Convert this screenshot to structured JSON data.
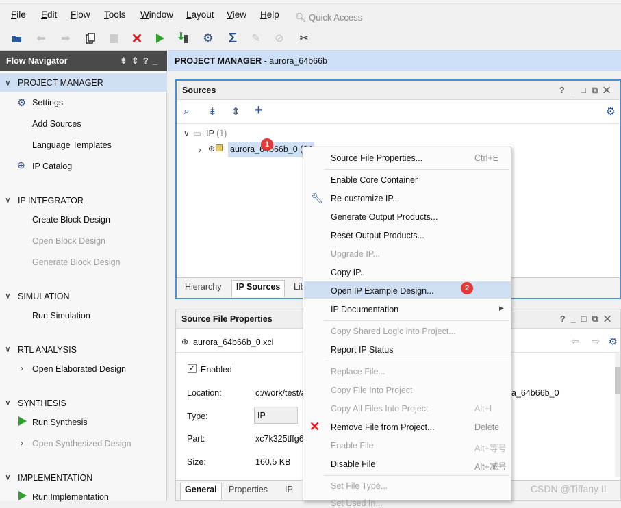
{
  "menubar": {
    "items": [
      "File",
      "Edit",
      "Flow",
      "Tools",
      "Window",
      "Layout",
      "View",
      "Help"
    ],
    "quick_access": "Quick Access"
  },
  "flow_navigator": {
    "title": "Flow Navigator",
    "sections": [
      {
        "title": "PROJECT MANAGER",
        "items": [
          {
            "label": "Settings",
            "icon": "gear-icon"
          },
          {
            "label": "Add Sources"
          },
          {
            "label": "Language Templates"
          },
          {
            "label": "IP Catalog",
            "icon": "ip-icon"
          }
        ]
      },
      {
        "title": "IP INTEGRATOR",
        "items": [
          {
            "label": "Create Block Design"
          },
          {
            "label": "Open Block Design",
            "disabled": true
          },
          {
            "label": "Generate Block Design",
            "disabled": true
          }
        ]
      },
      {
        "title": "SIMULATION",
        "items": [
          {
            "label": "Run Simulation"
          }
        ]
      },
      {
        "title": "RTL ANALYSIS",
        "items": [
          {
            "label": "Open Elaborated Design"
          }
        ]
      },
      {
        "title": "SYNTHESIS",
        "items": [
          {
            "label": "Run Synthesis"
          },
          {
            "label": "Open Synthesized Design",
            "disabled": true
          }
        ]
      },
      {
        "title": "IMPLEMENTATION",
        "items": [
          {
            "label": "Run Implementation"
          }
        ]
      }
    ]
  },
  "project_bar": {
    "title": "PROJECT MANAGER",
    "project": " - aurora_64b66b"
  },
  "sources": {
    "title": "Sources",
    "tree_root": "IP",
    "tree_root_count": " (1)",
    "tree_item": "aurora_64b66b_0 (64",
    "tabs": [
      "Hierarchy",
      "IP Sources",
      "Lib"
    ]
  },
  "source_file_properties": {
    "title": "Source File Properties",
    "file": "aurora_64b66b_0.xci",
    "enabled_label": "Enabled",
    "location_label": "Location:",
    "location_value": "c:/work/test/a",
    "location_tail": "a_64b66b_0",
    "type_label": "Type:",
    "type_value": "IP",
    "part_label": "Part:",
    "part_value": "xc7k325tffg6",
    "size_label": "Size:",
    "size_value": "160.5 KB",
    "tabs": [
      "General",
      "Properties",
      "IP"
    ]
  },
  "context_menu": {
    "items": [
      {
        "label": "Source File Properties...",
        "shortcut": "Ctrl+E"
      },
      {
        "label": "Enable Core Container"
      },
      {
        "label": "Re-customize IP...",
        "icon": "wrench-icon"
      },
      {
        "label": "Generate Output Products..."
      },
      {
        "label": "Reset Output Products..."
      },
      {
        "label": "Upgrade IP...",
        "disabled": true
      },
      {
        "label": "Copy IP..."
      },
      {
        "label": "Open IP Example Design...",
        "highlighted": true
      },
      {
        "label": "IP Documentation",
        "submenu": true
      },
      {
        "label": "Copy Shared Logic into Project...",
        "disabled": true
      },
      {
        "label": "Report IP Status"
      },
      {
        "label": "Replace File...",
        "disabled": true
      },
      {
        "label": "Copy File Into Project",
        "disabled": true
      },
      {
        "label": "Copy All Files Into Project",
        "disabled": true,
        "shortcut": "Alt+I"
      },
      {
        "label": "Remove File from Project...",
        "icon": "red-x-icon",
        "shortcut": "Delete"
      },
      {
        "label": "Enable File",
        "disabled": true,
        "shortcut": "Alt+等号"
      },
      {
        "label": "Disable File",
        "shortcut": "Alt+减号"
      },
      {
        "label": "Set File Type...",
        "disabled": true
      },
      {
        "label": "Set Used In...",
        "disabled": true
      }
    ]
  },
  "badges": [
    "1",
    "2"
  ],
  "watermark": "CSDN @Tiffany II",
  "colors": {
    "accent": "#4c8ed8",
    "selection": "#cfe0f5",
    "badge": "#e53935",
    "run_green": "#2ea12e"
  }
}
